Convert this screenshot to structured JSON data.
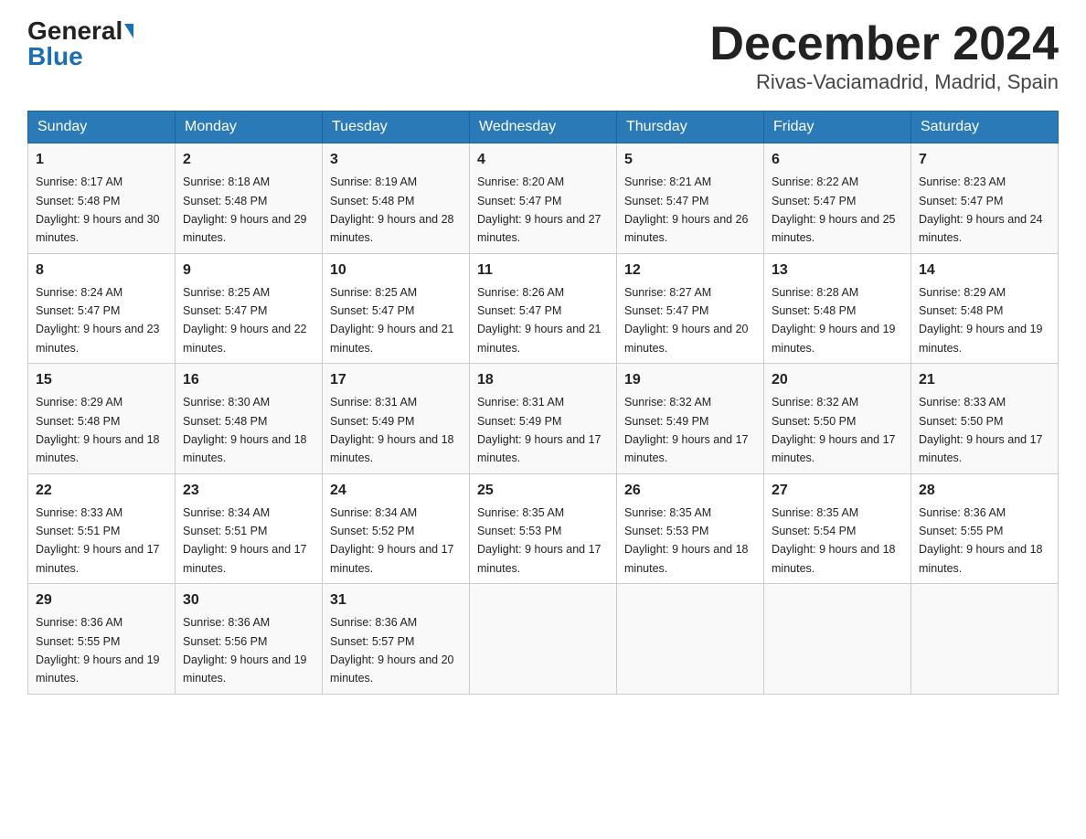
{
  "header": {
    "logo_general": "General",
    "logo_blue": "Blue",
    "title": "December 2024",
    "subtitle": "Rivas-Vaciamadrid, Madrid, Spain"
  },
  "weekdays": [
    "Sunday",
    "Monday",
    "Tuesday",
    "Wednesday",
    "Thursday",
    "Friday",
    "Saturday"
  ],
  "weeks": [
    [
      {
        "day": "1",
        "sunrise": "8:17 AM",
        "sunset": "5:48 PM",
        "daylight": "9 hours and 30 minutes."
      },
      {
        "day": "2",
        "sunrise": "8:18 AM",
        "sunset": "5:48 PM",
        "daylight": "9 hours and 29 minutes."
      },
      {
        "day": "3",
        "sunrise": "8:19 AM",
        "sunset": "5:48 PM",
        "daylight": "9 hours and 28 minutes."
      },
      {
        "day": "4",
        "sunrise": "8:20 AM",
        "sunset": "5:47 PM",
        "daylight": "9 hours and 27 minutes."
      },
      {
        "day": "5",
        "sunrise": "8:21 AM",
        "sunset": "5:47 PM",
        "daylight": "9 hours and 26 minutes."
      },
      {
        "day": "6",
        "sunrise": "8:22 AM",
        "sunset": "5:47 PM",
        "daylight": "9 hours and 25 minutes."
      },
      {
        "day": "7",
        "sunrise": "8:23 AM",
        "sunset": "5:47 PM",
        "daylight": "9 hours and 24 minutes."
      }
    ],
    [
      {
        "day": "8",
        "sunrise": "8:24 AM",
        "sunset": "5:47 PM",
        "daylight": "9 hours and 23 minutes."
      },
      {
        "day": "9",
        "sunrise": "8:25 AM",
        "sunset": "5:47 PM",
        "daylight": "9 hours and 22 minutes."
      },
      {
        "day": "10",
        "sunrise": "8:25 AM",
        "sunset": "5:47 PM",
        "daylight": "9 hours and 21 minutes."
      },
      {
        "day": "11",
        "sunrise": "8:26 AM",
        "sunset": "5:47 PM",
        "daylight": "9 hours and 21 minutes."
      },
      {
        "day": "12",
        "sunrise": "8:27 AM",
        "sunset": "5:47 PM",
        "daylight": "9 hours and 20 minutes."
      },
      {
        "day": "13",
        "sunrise": "8:28 AM",
        "sunset": "5:48 PM",
        "daylight": "9 hours and 19 minutes."
      },
      {
        "day": "14",
        "sunrise": "8:29 AM",
        "sunset": "5:48 PM",
        "daylight": "9 hours and 19 minutes."
      }
    ],
    [
      {
        "day": "15",
        "sunrise": "8:29 AM",
        "sunset": "5:48 PM",
        "daylight": "9 hours and 18 minutes."
      },
      {
        "day": "16",
        "sunrise": "8:30 AM",
        "sunset": "5:48 PM",
        "daylight": "9 hours and 18 minutes."
      },
      {
        "day": "17",
        "sunrise": "8:31 AM",
        "sunset": "5:49 PM",
        "daylight": "9 hours and 18 minutes."
      },
      {
        "day": "18",
        "sunrise": "8:31 AM",
        "sunset": "5:49 PM",
        "daylight": "9 hours and 17 minutes."
      },
      {
        "day": "19",
        "sunrise": "8:32 AM",
        "sunset": "5:49 PM",
        "daylight": "9 hours and 17 minutes."
      },
      {
        "day": "20",
        "sunrise": "8:32 AM",
        "sunset": "5:50 PM",
        "daylight": "9 hours and 17 minutes."
      },
      {
        "day": "21",
        "sunrise": "8:33 AM",
        "sunset": "5:50 PM",
        "daylight": "9 hours and 17 minutes."
      }
    ],
    [
      {
        "day": "22",
        "sunrise": "8:33 AM",
        "sunset": "5:51 PM",
        "daylight": "9 hours and 17 minutes."
      },
      {
        "day": "23",
        "sunrise": "8:34 AM",
        "sunset": "5:51 PM",
        "daylight": "9 hours and 17 minutes."
      },
      {
        "day": "24",
        "sunrise": "8:34 AM",
        "sunset": "5:52 PM",
        "daylight": "9 hours and 17 minutes."
      },
      {
        "day": "25",
        "sunrise": "8:35 AM",
        "sunset": "5:53 PM",
        "daylight": "9 hours and 17 minutes."
      },
      {
        "day": "26",
        "sunrise": "8:35 AM",
        "sunset": "5:53 PM",
        "daylight": "9 hours and 18 minutes."
      },
      {
        "day": "27",
        "sunrise": "8:35 AM",
        "sunset": "5:54 PM",
        "daylight": "9 hours and 18 minutes."
      },
      {
        "day": "28",
        "sunrise": "8:36 AM",
        "sunset": "5:55 PM",
        "daylight": "9 hours and 18 minutes."
      }
    ],
    [
      {
        "day": "29",
        "sunrise": "8:36 AM",
        "sunset": "5:55 PM",
        "daylight": "9 hours and 19 minutes."
      },
      {
        "day": "30",
        "sunrise": "8:36 AM",
        "sunset": "5:56 PM",
        "daylight": "9 hours and 19 minutes."
      },
      {
        "day": "31",
        "sunrise": "8:36 AM",
        "sunset": "5:57 PM",
        "daylight": "9 hours and 20 minutes."
      },
      null,
      null,
      null,
      null
    ]
  ]
}
